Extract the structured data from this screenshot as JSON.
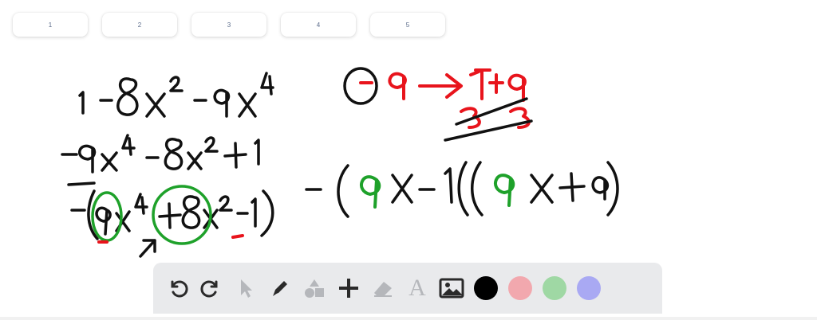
{
  "page_tabs": [
    "1",
    "2",
    "3",
    "4",
    "5"
  ],
  "toolbar": {
    "tools": [
      {
        "name": "undo-icon"
      },
      {
        "name": "redo-icon"
      },
      {
        "name": "pointer-icon"
      },
      {
        "name": "pen-icon"
      },
      {
        "name": "shapes-icon"
      },
      {
        "name": "plus-icon"
      },
      {
        "name": "eraser-icon"
      },
      {
        "name": "text-icon",
        "glyph": "A"
      },
      {
        "name": "image-icon"
      }
    ],
    "colors": [
      "#000000",
      "#f2a8ae",
      "#9fd8a4",
      "#a9a9f3"
    ]
  },
  "ink_colors": {
    "black": "#111111",
    "red": "#e8141c",
    "green": "#1ea12a"
  }
}
